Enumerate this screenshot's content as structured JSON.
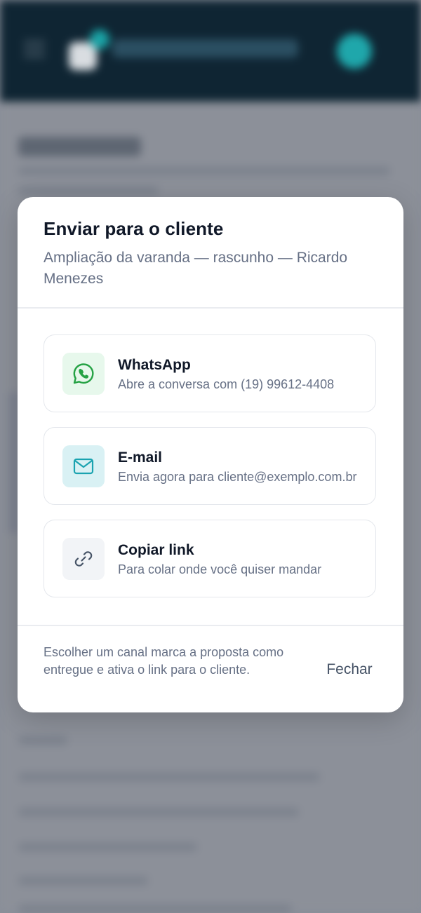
{
  "colors": {
    "header_bg": "#0f2533",
    "whatsapp_green": "#25a244",
    "whatsapp_bg": "#e7f8ec",
    "email_teal": "#1aa3b0",
    "email_bg": "#d9f1f4",
    "link_gray": "#475467",
    "link_bg": "#f2f4f7"
  },
  "modal": {
    "title": "Enviar para o cliente",
    "subtitle": "Ampliação da varanda — rascunho — Ricardo Menezes",
    "options": [
      {
        "icon": "whatsapp-icon",
        "title": "WhatsApp",
        "description": "Abre a conversa com (19) 99612-4408"
      },
      {
        "icon": "mail-icon",
        "title": "E-mail",
        "description": "Envia agora para cliente@exemplo.com.br"
      },
      {
        "icon": "link-icon",
        "title": "Copiar link",
        "description": "Para colar onde você quiser mandar"
      }
    ],
    "footer_note": "Escolher um canal marca a proposta como entregue e ativa o link para o cliente.",
    "close_label": "Fechar"
  }
}
